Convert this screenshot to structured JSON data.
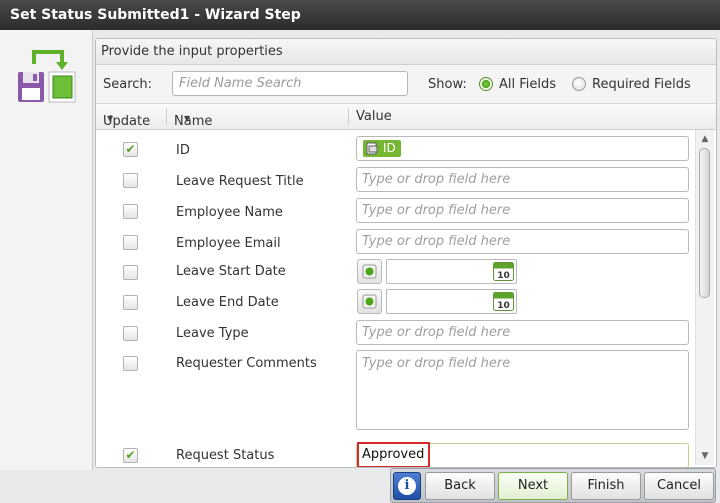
{
  "window": {
    "title": "Set Status Submitted1 - Wizard Step"
  },
  "panel": {
    "header": "Provide the input properties"
  },
  "search": {
    "label": "Search:",
    "placeholder": "Field Name Search"
  },
  "show": {
    "label": "Show:",
    "options": [
      {
        "label": "All Fields",
        "selected": true
      },
      {
        "label": "Required Fields",
        "selected": false
      }
    ]
  },
  "columns": {
    "update": "Update",
    "name": "Name",
    "value": "Value"
  },
  "value_placeholder": "Type or drop field here",
  "fields": [
    {
      "name": "ID",
      "checked": true,
      "kind": "tag",
      "value": "ID"
    },
    {
      "name": "Leave Request Title",
      "checked": false,
      "kind": "text"
    },
    {
      "name": "Employee Name",
      "checked": false,
      "kind": "text"
    },
    {
      "name": "Employee Email",
      "checked": false,
      "kind": "text"
    },
    {
      "name": "Leave Start Date",
      "checked": false,
      "kind": "date",
      "calendar_day": "10"
    },
    {
      "name": "Leave End Date",
      "checked": false,
      "kind": "date",
      "calendar_day": "10"
    },
    {
      "name": "Leave Type",
      "checked": false,
      "kind": "text"
    },
    {
      "name": "Requester Comments",
      "checked": false,
      "kind": "multiline"
    },
    {
      "name": "Request Status",
      "checked": true,
      "kind": "value",
      "value": "Approved"
    }
  ],
  "buttons": {
    "info": "i",
    "back": "Back",
    "next": "Next",
    "finish": "Finish",
    "cancel": "Cancel"
  },
  "colors": {
    "accent_green": "#75b731",
    "highlight_red": "#d62a2a",
    "title_bar": "#333333"
  }
}
